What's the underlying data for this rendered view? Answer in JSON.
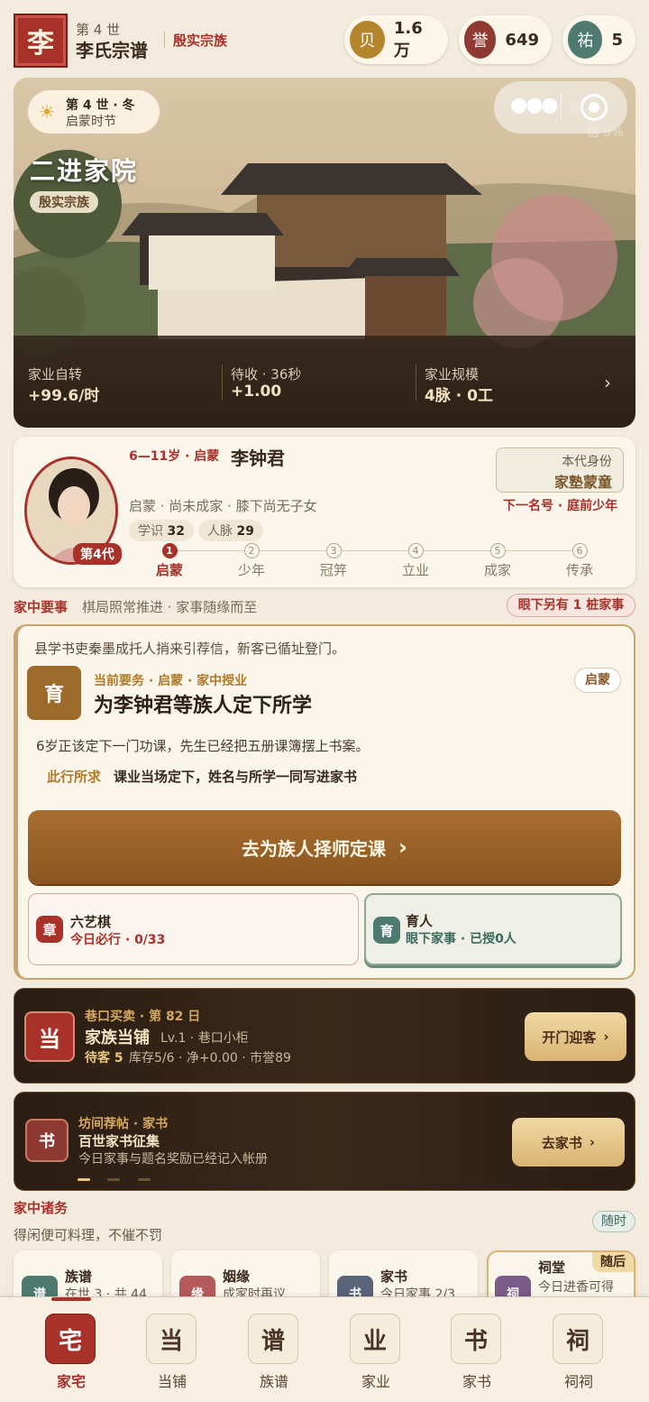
{
  "header": {
    "seal": "李",
    "gen": "第 4 世",
    "clan": "李氏宗谱",
    "rank": "殷实宗族"
  },
  "resources": [
    {
      "icon": "贝",
      "value": "1.6万",
      "color": "#b5852c"
    },
    {
      "icon": "誉",
      "value": "649",
      "color": "#8e3a32"
    },
    {
      "icon": "祐",
      "value": "5",
      "color": "#4f7a70"
    }
  ],
  "hero": {
    "season": "第 4 世 · 冬",
    "phase": "启蒙时节",
    "title": "二进家院",
    "rank": "殷实宗族",
    "faded": "族",
    "faded2": "信 9%",
    "stats": [
      {
        "label": "家业自转",
        "value": "+99.6/时"
      },
      {
        "label": "待收 · 36秒",
        "value": "+1.00"
      },
      {
        "label": "家业规模",
        "value": "4脉 · 0工"
      }
    ]
  },
  "person": {
    "age": "6—11岁 · 启蒙",
    "name": "李钟君",
    "gen": "第4代",
    "desc": "启蒙 · 尚未成家 · 膝下尚无子女",
    "stat1_label": "学识",
    "stat1_value": "32",
    "stat2_label": "人脉",
    "stat2_value": "29",
    "identity_label": "本代身份",
    "identity_value": "家塾蒙童",
    "next": "下一名号 · 庭前少年",
    "steps": [
      {
        "n": "1",
        "label": "启蒙"
      },
      {
        "n": "2",
        "label": "少年"
      },
      {
        "n": "3",
        "label": "冠笄"
      },
      {
        "n": "4",
        "label": "立业"
      },
      {
        "n": "5",
        "label": "成家"
      },
      {
        "n": "6",
        "label": "传承"
      }
    ]
  },
  "affairs": {
    "title": "家中要事",
    "subtitle": "棋局照常推进 · 家事随缘而至",
    "badge": "眼下另有 1 桩家事"
  },
  "task": {
    "note": "县学书吏秦墨成托人捎来引荐信，新客已循址登门。",
    "icon": "育",
    "meta": "当前要务 · 启蒙 · 家中授业",
    "title": "为李钟君等族人定下所学",
    "tag": "启蒙",
    "desc": "6岁正该定下一门功课，先生已经把五册课簿摆上书案。",
    "goal_label": "此行所求",
    "goal": "课业当场定下，姓名与所学一同写进家书",
    "button": "去为族人择师定课",
    "sub": [
      {
        "icon": "章",
        "title": "六艺棋",
        "detail": "今日必行 · 0/33"
      },
      {
        "icon": "育",
        "title": "育人",
        "detail": "眼下家事 · 已授0人"
      }
    ]
  },
  "shop": {
    "icon": "当",
    "meta": "巷口买卖 · 第 82 日",
    "name": "家族当铺",
    "level": "Lv.1 · 巷口小柜",
    "stats": "待客 5",
    "stats2": "库存5/6 · 净+0.00 · 市誉89",
    "button": "开门迎客"
  },
  "letter": {
    "icon": "书",
    "meta": "坊间荐帖 · 家书",
    "title": "百世家书征集",
    "desc": "今日家事与题名奖励已经记入帐册",
    "button": "去家书"
  },
  "chores": {
    "title": "家中诸务",
    "subtitle": "得闲便可料理，不催不罚",
    "tag": "随时",
    "items": [
      {
        "icon": "谱",
        "title": "族谱",
        "detail": "在世 3 · 共 44"
      },
      {
        "icon": "缘",
        "title": "姻缘",
        "detail": "成家时再议"
      },
      {
        "icon": "书",
        "title": "家书",
        "detail": "今日家事 2/3"
      },
      {
        "icon": "祠",
        "title": "祠堂",
        "detail": "今日进香可得",
        "tag": "随后"
      }
    ]
  },
  "nav": [
    {
      "icon": "宅",
      "label": "家宅"
    },
    {
      "icon": "当",
      "label": "当铺"
    },
    {
      "icon": "谱",
      "label": "族谱"
    },
    {
      "icon": "业",
      "label": "家业"
    },
    {
      "icon": "书",
      "label": "家书"
    },
    {
      "icon": "祠",
      "label": "祠祠"
    }
  ]
}
